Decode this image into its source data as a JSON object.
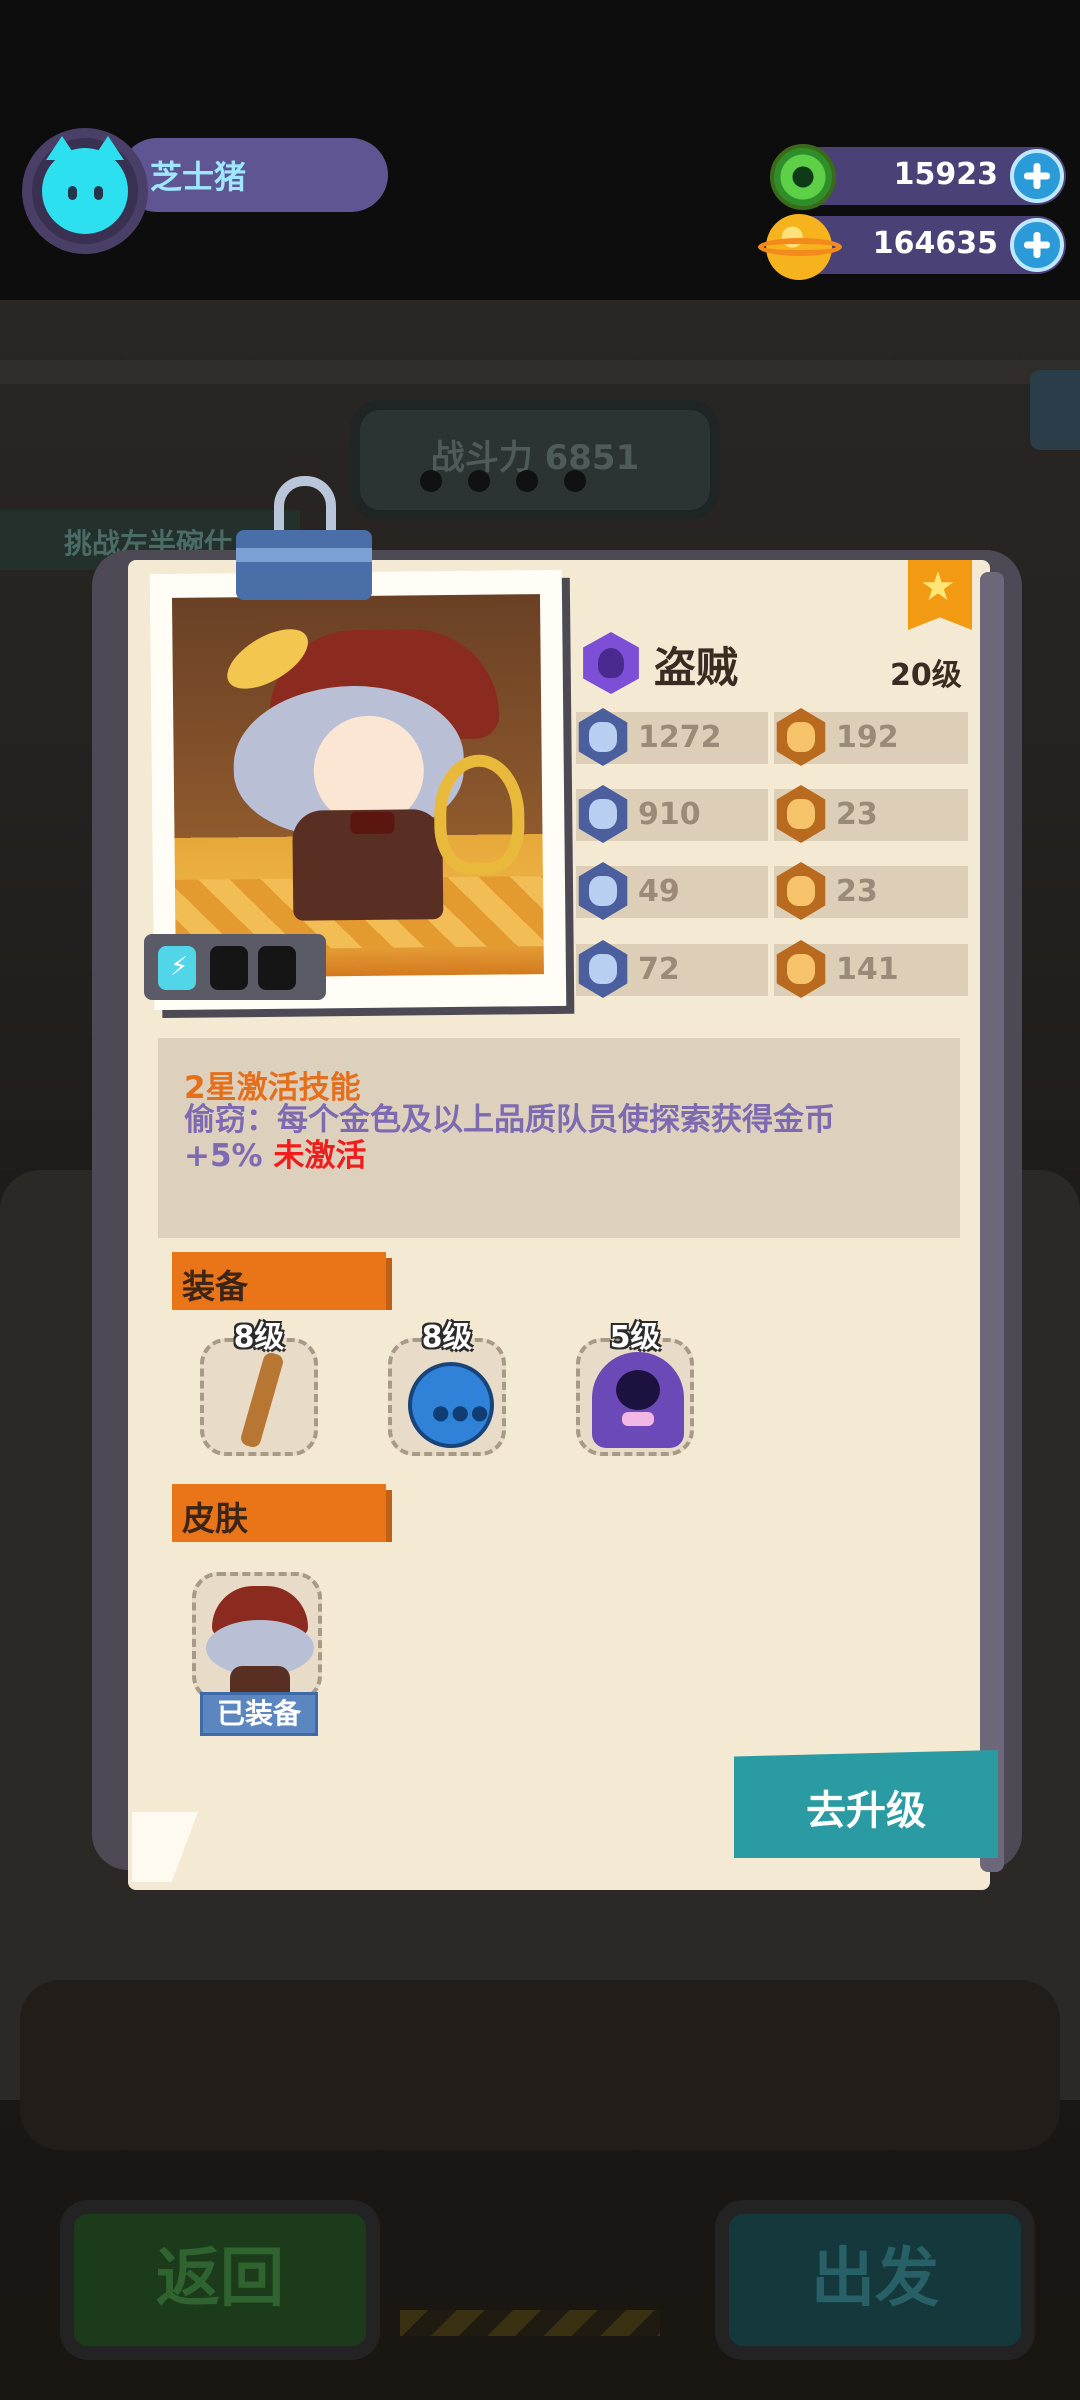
{
  "player": {
    "name": "芝士猪"
  },
  "currencies": [
    {
      "name": "gems",
      "value": "15923",
      "icon": "green-gem-icon"
    },
    {
      "name": "gold",
      "value": "164635",
      "icon": "planet-coin-icon"
    }
  ],
  "background": {
    "power_label": "战斗力 6851",
    "challenge_label": "挑战左半碗仕",
    "back_label": "返回",
    "go_label": "出发"
  },
  "hero": {
    "class": "盗贼",
    "level": "20级",
    "stats": {
      "hp": "1272",
      "attack": "192",
      "speed": "910",
      "luck": "23",
      "defense": "49",
      "strength": "23",
      "anchor": "72",
      "intelligence": "141"
    },
    "skill": {
      "title": "2星激活技能",
      "description": "偷窃：每个金色及以上品质队员使探索获得金币 +5% ",
      "state": "未激活"
    },
    "equipment_label": "装备",
    "equipment": [
      {
        "level": "8级",
        "icon": "flute-icon"
      },
      {
        "level": "8级",
        "icon": "blue-potion-icon"
      },
      {
        "level": "5级",
        "icon": "purple-cloak-icon"
      }
    ],
    "skin_label": "皮肤",
    "skin_status": "已装备",
    "upgrade_label": "去升级"
  },
  "colors": {
    "accent_orange": "#ea7418",
    "upgrade_teal": "#2a9aa3",
    "inactive_red": "#f01d1d",
    "skill_purple": "#7e6ab0"
  }
}
